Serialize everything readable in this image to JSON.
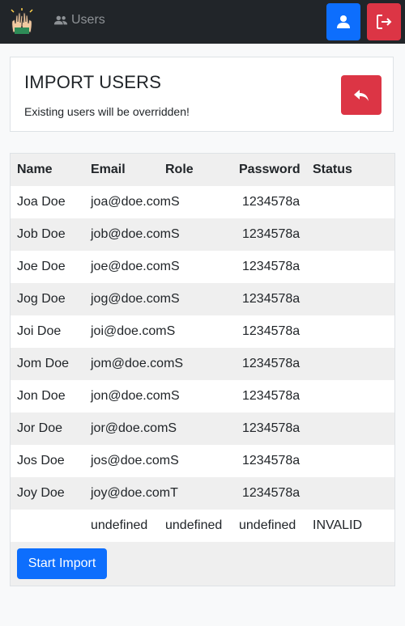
{
  "navbar": {
    "brand_icon": "raised-hands-logo",
    "users_link_label": "Users",
    "users_icon": "users-icon",
    "profile_icon": "user-icon",
    "logout_icon": "logout-icon",
    "colors": {
      "background": "#212529",
      "primary": "#0d6efd",
      "danger": "#dc3545"
    }
  },
  "header": {
    "title": "IMPORT USERS",
    "warning": "Existing users will be overridden!",
    "back_icon": "reply-arrow-icon"
  },
  "table": {
    "columns": [
      "Name",
      "Email",
      "Role",
      "Password",
      "Status"
    ],
    "rows": [
      {
        "name": "Joa Doe",
        "email": "joa@doe.com",
        "role": "S",
        "password": "1234578a",
        "status": ""
      },
      {
        "name": "Job Doe",
        "email": "job@doe.com",
        "role": "S",
        "password": "1234578a",
        "status": ""
      },
      {
        "name": "Joe Doe",
        "email": "joe@doe.com",
        "role": "S",
        "password": "1234578a",
        "status": ""
      },
      {
        "name": "Jog Doe",
        "email": "jog@doe.com",
        "role": "S",
        "password": "1234578a",
        "status": ""
      },
      {
        "name": "Joi Doe",
        "email": "joi@doe.com",
        "role": "S",
        "password": "1234578a",
        "status": ""
      },
      {
        "name": "Jom Doe",
        "email": "jom@doe.com",
        "role": "S",
        "password": "1234578a",
        "status": ""
      },
      {
        "name": "Jon Doe",
        "email": "jon@doe.com",
        "role": "S",
        "password": "1234578a",
        "status": ""
      },
      {
        "name": "Jor Doe",
        "email": "jor@doe.com",
        "role": "S",
        "password": "1234578a",
        "status": ""
      },
      {
        "name": "Jos Doe",
        "email": "jos@doe.com",
        "role": "S",
        "password": "1234578a",
        "status": ""
      },
      {
        "name": "Joy Doe",
        "email": "joy@doe.com",
        "role": "T",
        "password": "1234578a",
        "status": ""
      },
      {
        "name": "",
        "email": "undefined",
        "role": "undefined",
        "password": "undefined",
        "status": "INVALID"
      }
    ]
  },
  "actions": {
    "start_import_label": "Start Import"
  }
}
